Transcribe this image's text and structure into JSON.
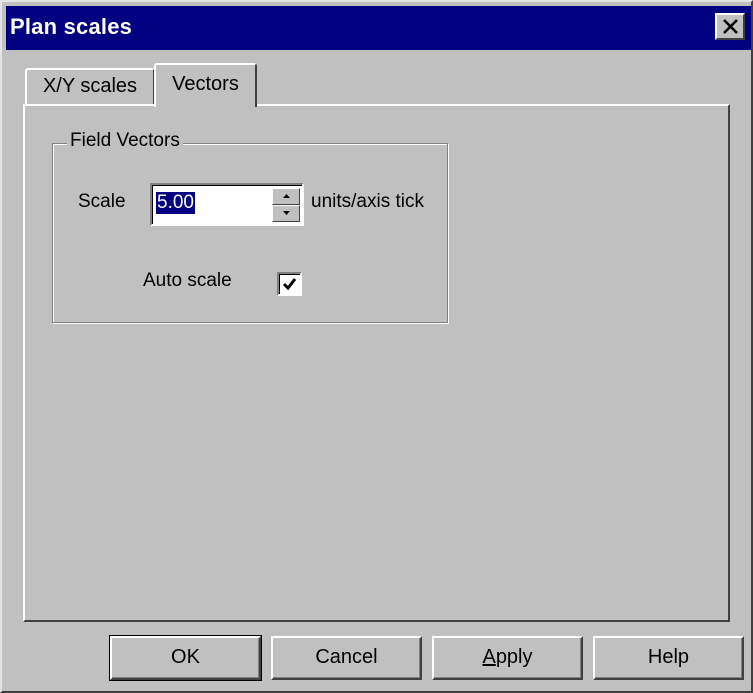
{
  "window": {
    "title": "Plan scales"
  },
  "tabs": [
    {
      "label": "X/Y scales",
      "active": false
    },
    {
      "label": "Vectors",
      "active": true
    }
  ],
  "field_vectors": {
    "group_label": "Field Vectors",
    "scale_label": "Scale",
    "scale_value": "5.00",
    "units_label": "units/axis tick",
    "auto_scale_label": "Auto scale",
    "auto_scale_checked": true
  },
  "buttons": {
    "ok": "OK",
    "cancel": "Cancel",
    "apply_mnemonic": "A",
    "apply_rest": "pply",
    "help": "Help"
  },
  "icons": {
    "close": "close-icon",
    "spin_up": "spin-up-arrow-icon",
    "spin_down": "spin-down-arrow-icon",
    "checkmark": "checkmark-icon"
  },
  "colors": {
    "titlebar": "#000080",
    "face": "#c0c0c0",
    "selection": "#000080"
  }
}
